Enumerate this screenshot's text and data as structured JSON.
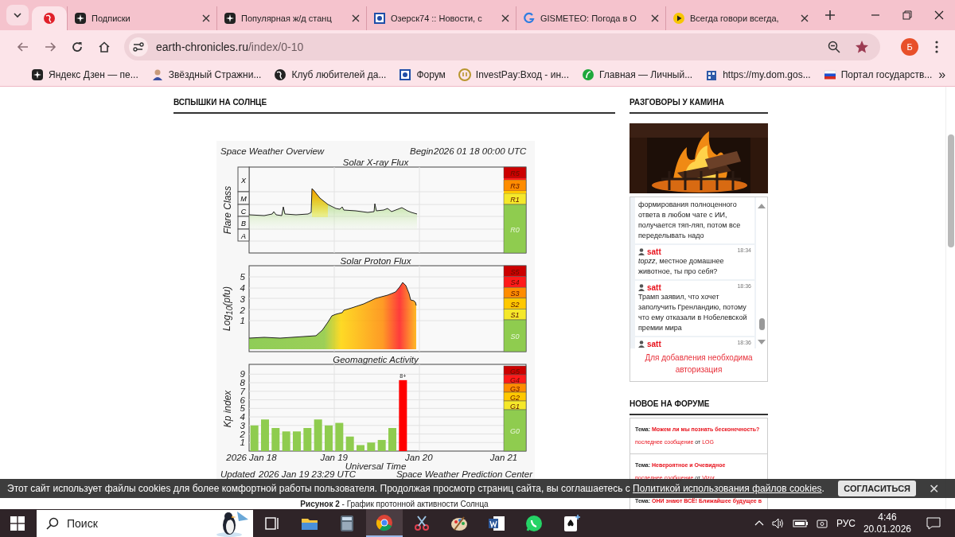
{
  "browser": {
    "tabs": [
      {
        "selected": true
      },
      {
        "title": "Подписки",
        "selected": false
      },
      {
        "title": "Популярная ж/д станц",
        "selected": false
      },
      {
        "title": "Озерск74 :: Новости, с",
        "selected": false
      },
      {
        "title": "GISMETEO: Погода в О",
        "selected": false
      },
      {
        "title": "Всегда говори всегда,",
        "selected": false
      }
    ],
    "address": {
      "host": "earth-chronicles.ru",
      "path": "/index/0-10"
    },
    "profile": "Б",
    "bookmarks": [
      {
        "title": "Яндекс Дзен — пе..."
      },
      {
        "title": "Звёздный Стражни..."
      },
      {
        "title": "Клуб любителей да..."
      },
      {
        "title": "Форум"
      },
      {
        "title": "InvestPay:Вход - ин..."
      },
      {
        "title": "Главная — Личный..."
      },
      {
        "title": "https://my.dom.gos..."
      },
      {
        "title": "Портал государств..."
      }
    ],
    "more_bookmarks": "»"
  },
  "page": {
    "heading": "ВСПЫШКИ НА СОЛНЦЕ",
    "figure": {
      "overview": "Space Weather Overview",
      "begin_label": "Begin",
      "begin": "2026 01 18 00:00 UTC",
      "xray": {
        "title": "Solar X-ray Flux",
        "ylabel": "Flare Class",
        "classes": [
          "X",
          "M",
          "C",
          "B",
          "A"
        ],
        "scale": [
          {
            "label": "R5",
            "color": "#cc0000"
          },
          {
            "label": "R3",
            "color": "#ff8c00"
          },
          {
            "label": "R1",
            "color": "#f5e82a"
          },
          {
            "label": "R0",
            "color": "#8fcc4f"
          }
        ]
      },
      "proton": {
        "title": "Solar Proton Flux",
        "ylabel": "Log$_{10}$(pfu)",
        "yticks": [
          "5",
          "4",
          "3",
          "2",
          "1"
        ],
        "scale": [
          {
            "label": "S5",
            "color": "#cc0000"
          },
          {
            "label": "S4",
            "color": "#ff1a1a"
          },
          {
            "label": "S3",
            "color": "#ff8c00"
          },
          {
            "label": "S2",
            "color": "#ffc800"
          },
          {
            "label": "S1",
            "color": "#f5e82a"
          },
          {
            "label": "S0",
            "color": "#8fcc4f"
          }
        ]
      },
      "kp": {
        "scale": [
          {
            "label": "G5",
            "color": "#cc0000"
          },
          {
            "label": "G4",
            "color": "#ff1a1a"
          },
          {
            "label": "G3",
            "color": "#ff8c00"
          },
          {
            "label": "G2",
            "color": "#ffc800"
          },
          {
            "label": "G1",
            "color": "#f5e82a"
          },
          {
            "label": "G0",
            "color": "#8fcc4f"
          }
        ],
        "chart_data": {
          "type": "bar",
          "title": "Geomagnetic Activity",
          "xlabel": "Universal Time",
          "ylabel": "Kp index",
          "categories": [
            "2026 Jan 18",
            null,
            null,
            null,
            null,
            null,
            null,
            null,
            "Jan 19",
            null,
            null,
            null,
            null,
            null,
            null,
            null,
            "Jan 20",
            null,
            null,
            null,
            null,
            null,
            null,
            null,
            "Jan 21"
          ],
          "ylim": [
            0,
            10
          ],
          "yticks": [
            1,
            2,
            3,
            4,
            5,
            6,
            7,
            8,
            9
          ],
          "stacked": true,
          "series": [
            {
              "color": "#8fcc4f",
              "values": [
                3,
                3.7,
                2.7,
                2.3,
                2.3,
                2.7,
                3.7,
                3,
                3.3,
                1.7,
                0.7,
                1,
                1.3,
                2.7,
                null,
                null,
                null,
                null,
                null,
                null,
                null,
                null,
                null,
                null,
                null
              ]
            },
            {
              "color": "#ff0000",
              "values": [
                null,
                null,
                null,
                null,
                null,
                null,
                null,
                null,
                null,
                null,
                null,
                null,
                null,
                null,
                8.3,
                null,
                null,
                null,
                null,
                null,
                null,
                null,
                null,
                null,
                null
              ]
            }
          ],
          "grid": true,
          "annotations": [
            {
              "y": 8.3,
              "text": "8+"
            }
          ]
        }
      },
      "updated_label": "Updated",
      "updated": "2026 Jan 19 23:29 UTC",
      "credit": "Space Weather Prediction Center"
    },
    "caption": "**Рисунок 2** - График протонной активности Солнца"
  },
  "chat": {
    "heading": "РАЗГОВОРЫ У КАМИНА",
    "messages": [
      {
        "text": "формирования полноценного ответа в любом чате с ИИ, получается тяп-ляп, потом все переделывать надо"
      },
      {
        "author": "satt",
        "time": "18:34",
        "text": "*topzz*, местное домашнее животное, ты про себя?"
      },
      {
        "author": "satt",
        "time": "18:36",
        "text": "Трамп заявил, что хочет заполучить Гренландию, потому что ему отказали в Нобелевской премии мира"
      },
      {
        "author": "satt",
        "time": "18:36"
      }
    ],
    "notice": "Для добавления необходима авторизация"
  },
  "forum": {
    "heading": "НОВОЕ НА ФОРУМЕ",
    "items": [
      {
        "label": "Тема:",
        "topic": "Можем ли мы познать бесконечность?",
        "last": "последнее сообщение",
        "from": "от",
        "user": "LOG"
      },
      {
        "label": "Тема:",
        "topic": "Невероятное и Очевидное",
        "last": "последнее сообщение",
        "from": "от",
        "user": "Vizor"
      },
      {
        "label": "Тема:",
        "topic": "ОНИ знают ВСЁ! Ближайшее будущее в"
      }
    ]
  },
  "cookie": {
    "text": "Этот сайт использует файлы cookies для более комфортной работы пользователя. Продолжая просмотр страниц сайта, вы соглашаетесь с",
    "link": "Политикой использования файлов cookies",
    "end": ".",
    "button": "СОГЛАСИТЬСЯ",
    "close": "✕"
  },
  "taskbar": {
    "search": "Поиск",
    "apps": [
      {
        "kind": "task-view",
        "active": false
      },
      {
        "kind": "folder",
        "active": false
      },
      {
        "kind": "calculator",
        "active": false
      },
      {
        "kind": "chrome",
        "active": true
      },
      {
        "kind": "scissors",
        "active": false
      },
      {
        "kind": "palette",
        "active": false
      },
      {
        "kind": "word",
        "active": false
      },
      {
        "kind": "whatsapp",
        "active": false
      },
      {
        "kind": "cards",
        "active": false
      }
    ],
    "language": "РУС",
    "time": "4:46",
    "date": "20.01.2026"
  }
}
